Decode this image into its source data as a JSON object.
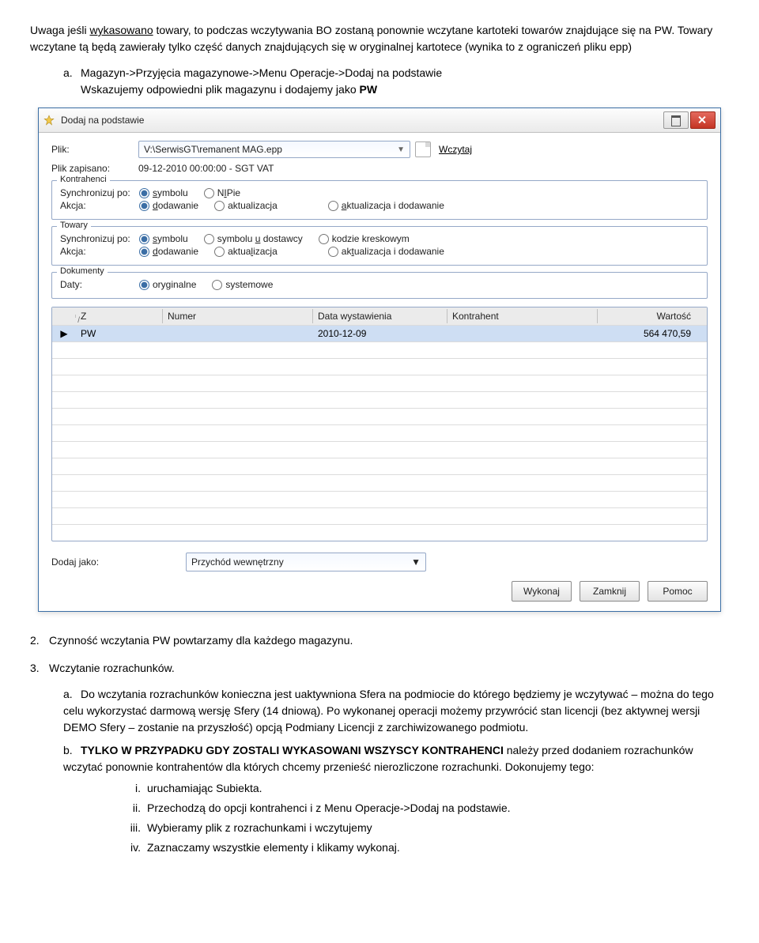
{
  "intro_part1": "Uwaga jeśli ",
  "intro_underline": "wykasowano",
  "intro_part2": " towary, to podczas wczytywania BO zostaną ponownie wczytane kartoteki towarów znajdujące się na PW. Towary wczytane tą będą zawierały tylko część danych znajdujących się w oryginalnej kartotece (wynika to z ograniczeń pliku epp)",
  "item_a_line1": "Magazyn->Przyjęcia magazynowe->Menu Operacje->Dodaj na podstawie",
  "item_a_line2a": "Wskazujemy odpowiedni plik magazynu i dodajemy jako ",
  "item_a_line2b": "PW",
  "dialog": {
    "title": "Dodaj na podstawie",
    "plik_label": "Plik:",
    "plik_value": "V:\\SerwisGT\\remanent MAG.epp",
    "wczytaj": "Wczytaj",
    "zapisano_label": "Plik zapisano:",
    "zapisano_value": "09-12-2010 00:00:00 - SGT VAT",
    "kontrahenci": {
      "legend": "Kontrahenci",
      "sync_label": "Synchronizuj po:",
      "akcja_label": "Akcja:",
      "r_symbolu": "symbolu",
      "r_nipie_pre": "N",
      "r_nipie_post": "IPie",
      "r_dodawanie_pre": "d",
      "r_dodawanie_post": "odawanie",
      "r_aktualizacja": "aktualizacja",
      "r_aktdod_pre": "a",
      "r_aktdod_post": "ktualizacja i dodawanie"
    },
    "towary": {
      "legend": "Towary",
      "sync_label": "Synchronizuj po:",
      "akcja_label": "Akcja:",
      "r_symbolu": "symbolu",
      "r_symboludost_pre": "symbolu u ",
      "r_symboludost_post": "dostawcy",
      "r_kodzie": "kodzie kreskowym",
      "r_dodawanie_pre": "d",
      "r_dodawanie_post": "odawanie",
      "r_aktualizacja_pre": "aktua",
      "r_aktualizacja_post": "lizacja",
      "r_aktdod_pre": "ak",
      "r_aktdod_post": "tualizacja i dodawanie"
    },
    "dokumenty": {
      "legend": "Dokumenty",
      "daty_label": "Daty:",
      "r_oryginalne": "oryginalne",
      "r_systemowe": "systemowe"
    },
    "table": {
      "h_z": "Z",
      "h_numer": "Numer",
      "h_data": "Data wystawienia",
      "h_kontrahent": "Kontrahent",
      "h_wartosc": "Wartość",
      "row": {
        "z": "PW",
        "data": "2010-12-09",
        "wartosc": "564 470,59"
      }
    },
    "dodaj_label": "Dodaj jako:",
    "dodaj_value": "Przychód wewnętrzny",
    "btn_wykonaj": "Wykonaj",
    "btn_zamknij": "Zamknij",
    "btn_pomoc": "Pomoc"
  },
  "item2": "Czynność wczytania PW powtarzamy dla każdego magazynu.",
  "item3": "Wczytanie rozrachunków.",
  "item3a": "Do wczytania rozrachunków konieczna jest uaktywniona Sfera na podmiocie do którego będziemy je wczytywać – można do tego celu wykorzystać darmową wersję Sfery (14 dniową). Po wykonanej operacji możemy przywrócić stan licencji (bez aktywnej wersji DEMO Sfery – zostanie na przyszłość) opcją Podmiany Licencji z zarchiwizowanego podmiotu.",
  "item3b_bold": "TYLKO W PRZYPADKU GDY ZOSTALI WYKASOWANI WSZYSCY KONTRAHENCI",
  "item3b_rest": " należy przed dodaniem rozrachunków wczytać ponownie kontrahentów dla których chcemy przenieść nierozliczone rozrachunki. Dokonujemy tego:",
  "item3b_i": "uruchamiając Subiekta.",
  "item3b_ii": "Przechodzą do opcji kontrahenci i z Menu Operacje->Dodaj na podstawie.",
  "item3b_iii": "Wybieramy plik z rozrachunkami i wczytujemy",
  "item3b_iv": "Zaznaczamy wszystkie elementy i klikamy wykonaj."
}
